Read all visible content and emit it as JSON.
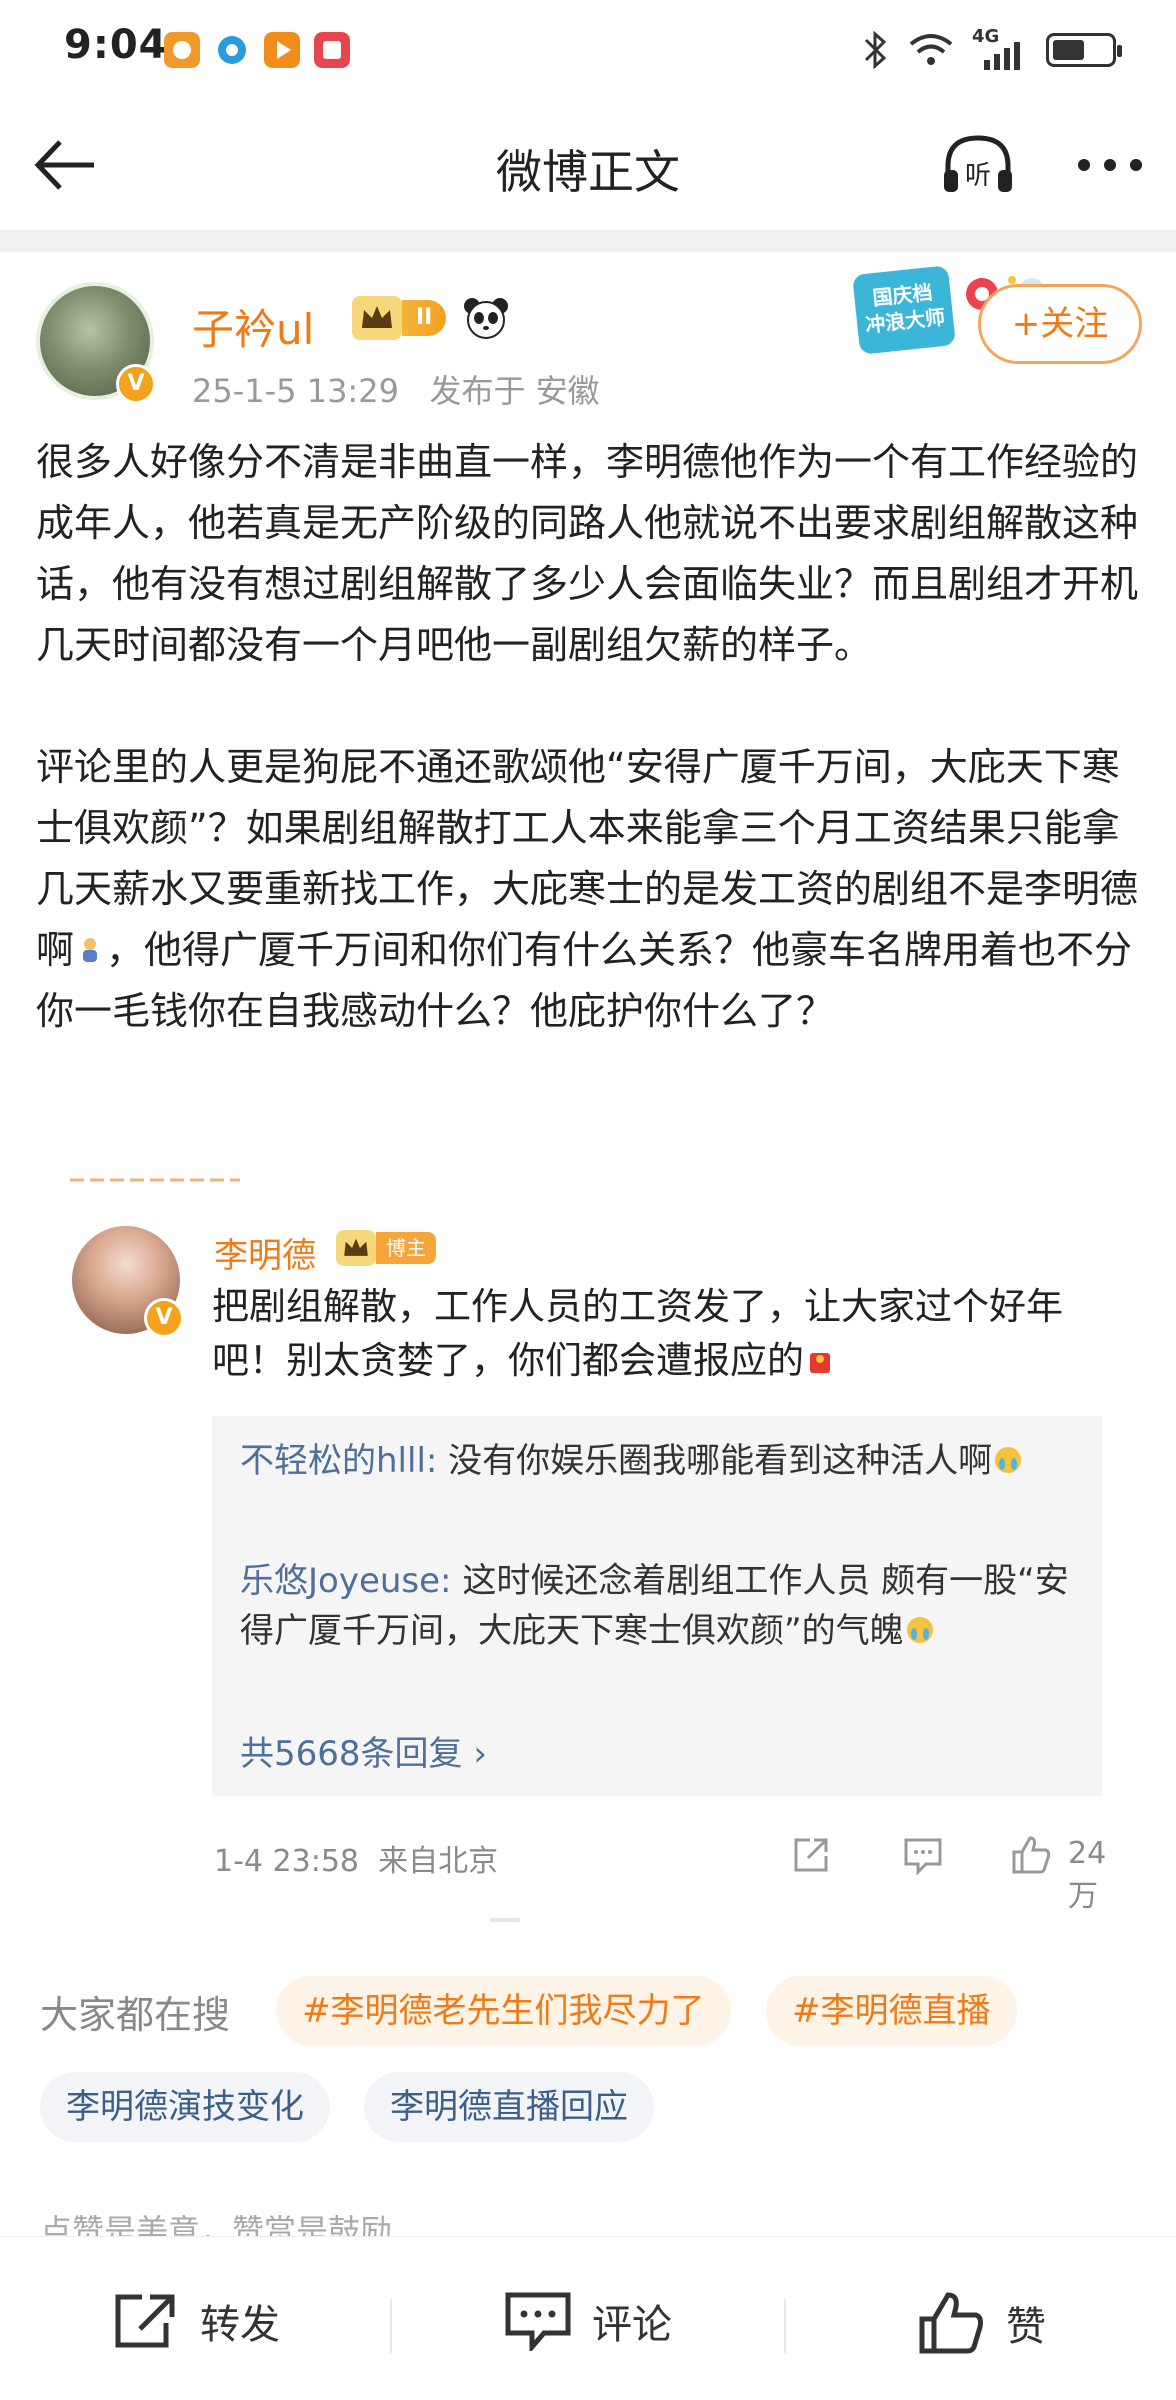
{
  "status_bar": {
    "time": "9:04",
    "network": "4G",
    "battery_level": 0.55
  },
  "nav": {
    "title": "微博正文",
    "listen_label": "听"
  },
  "author": {
    "name": "子衿ul",
    "rank": "II",
    "timestamp": "25-1-5 13:29",
    "location": "发布于 安徽",
    "promo_line1": "国庆档",
    "promo_line2": "冲浪大师",
    "follow_label": "+关注"
  },
  "post": {
    "paragraph1": "很多人好像分不清是非曲直一样，李明德他作为一个有工作经验的成年人，他若真是无产阶级的同路人他就说不出要求剧组解散这种话，他有没有想过剧组解散了多少人会面临失业？而且剧组才开机几天时间都没有一个月吧他一副剧组欠薪的样子。",
    "paragraph2_a": "评论里的人更是狗屁不通还歌颂他“安得广厦千万间，大庇天下寒士俱欢颜”？如果剧组解散打工人本来能拿三个月工资结果只能拿几天薪水又要重新找工作，大庇寒士的是发工资的剧组不是李明德啊",
    "paragraph2_b": "，他得广厦千万间和你们有什么关系？他豪车名牌用着也不分你一毛钱你在自我感动什么？他庇护你什么了？"
  },
  "quoted": {
    "name": "李明德",
    "badge": "博主",
    "text": "把剧组解散，工作人员的工资发了，让大家过个好年吧！别太贪婪了，你们都会遭报应的",
    "replies": [
      {
        "user": "不轻松的hlll:",
        "text": " 没有你娱乐圈我哪能看到这种活人啊"
      },
      {
        "user": "乐悠Joyeuse:",
        "text": " 这时候还念着剧组工作人员  颇有一股“安得广厦千万间，大庇天下寒士俱欢颜”的气魄"
      }
    ],
    "more_replies": "共5668条回复 ›",
    "time": "1-4 23:58",
    "source": "来自北京",
    "like_count": "24万"
  },
  "trending": {
    "label": "大家都在搜",
    "tags": [
      "#李明德老先生们我尽力了",
      "#李明德直播",
      "李明德演技变化",
      "李明德直播回应"
    ]
  },
  "reward_hint": "点赞是美意，赞赏是鼓励",
  "actions": {
    "repost": "转发",
    "comment": "评论",
    "like": "赞"
  },
  "colors": {
    "accent": "#f07a16",
    "link": "#4d6f9a"
  }
}
